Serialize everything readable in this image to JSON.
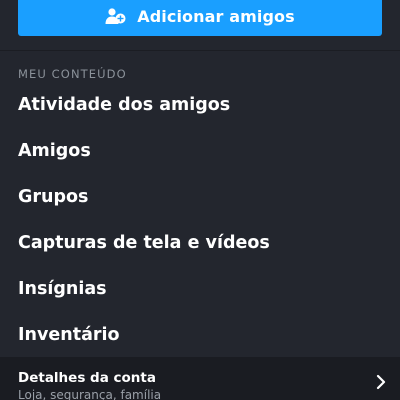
{
  "add_friends_button": {
    "label": "Adicionar amigos",
    "icon": "add-user-icon"
  },
  "my_content": {
    "section_title": "MEU CONTEÚDO",
    "items": [
      {
        "label": "Atividade dos amigos"
      },
      {
        "label": "Amigos"
      },
      {
        "label": "Grupos"
      },
      {
        "label": "Capturas de tela e vídeos"
      },
      {
        "label": "Insígnias"
      },
      {
        "label": "Inventário"
      }
    ]
  },
  "account_details": {
    "title": "Detalhes da conta",
    "subtitle": "Loja, segurança, família",
    "icon": "chevron-right-icon"
  },
  "colors": {
    "background": "#23262e",
    "accent_button": "#1a9fff",
    "section_title": "#8b929a",
    "account_row_background": "#1a1c22"
  }
}
